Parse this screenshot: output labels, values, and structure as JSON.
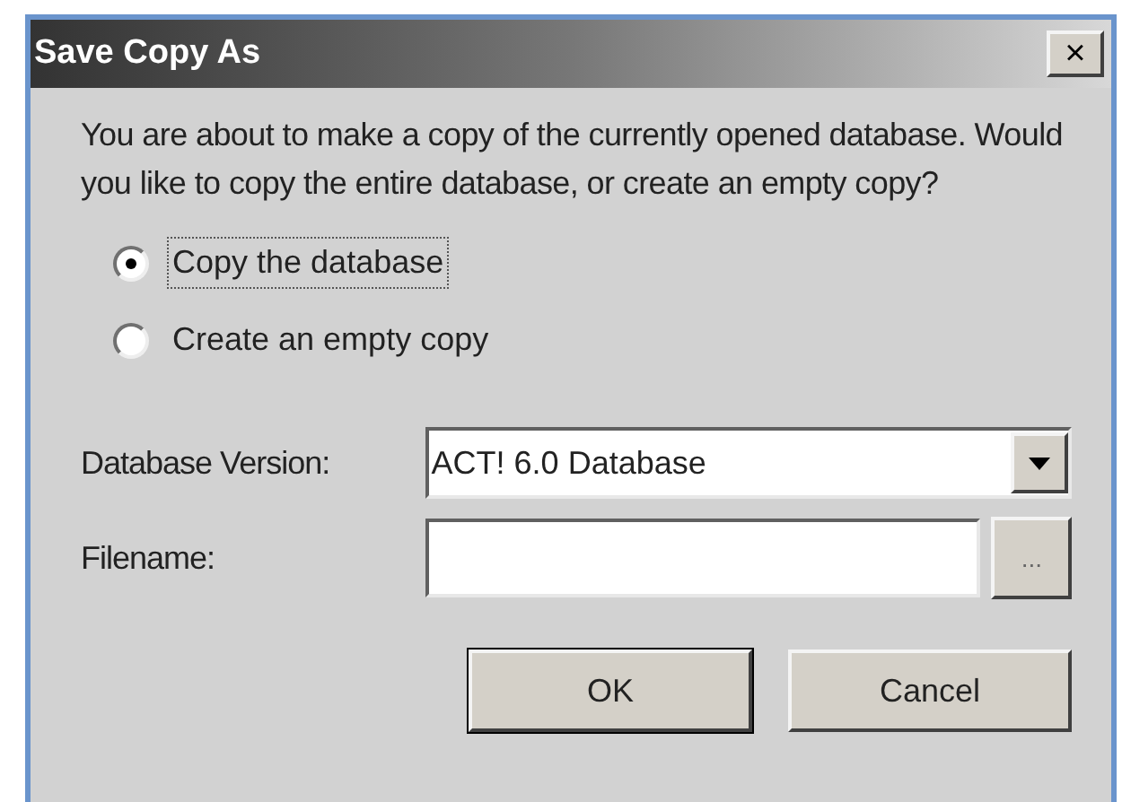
{
  "window": {
    "title": "Save Copy As",
    "close": "×"
  },
  "message": "You are about to make a copy of the currently opened database. Would you like to copy the entire database, or create an empty copy?",
  "options": [
    {
      "label": "Copy the database",
      "selected": true
    },
    {
      "label": "Create an empty copy",
      "selected": false
    }
  ],
  "database_version": {
    "label": "Database Version:",
    "value": "ACT! 6.0 Database"
  },
  "filename": {
    "label": "Filename:",
    "browse": "..."
  },
  "buttons": [
    "OK",
    "Cancel"
  ]
}
